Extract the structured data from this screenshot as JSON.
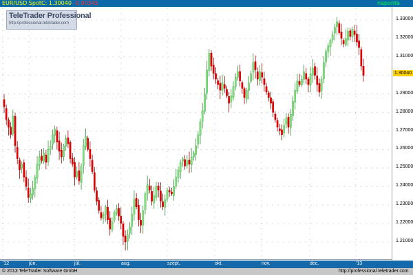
{
  "header": {
    "instrument": "EUR/USD Spot",
    "close_label": "C: 1.30040",
    "change": "-0.00345",
    "period": "naponta",
    "colors": {
      "instrument": "#ffff00",
      "close": "#ffff00",
      "change": "#ff3333",
      "period": "#00ff44",
      "bar": "#0a6aa8"
    }
  },
  "logo": {
    "title": "TeleTrader Professional",
    "url": "http://professional.teletrader.com"
  },
  "footer": {
    "copyright": "© 2013 TeleTrader Software GmbH",
    "site": "http://professional.teletrader.com"
  },
  "last_price_tag": "1.30040",
  "chart_data": {
    "type": "candlestick",
    "title": "",
    "ylim": [
      1.2,
      1.34
    ],
    "y_ticks": [
      "1.21000",
      "1.22000",
      "1.23000",
      "1.24000",
      "1.25000",
      "1.26000",
      "1.27000",
      "1.28000",
      "1.29000",
      "1.30000",
      "1.31000",
      "1.32000",
      "1.33000"
    ],
    "x_ticks": [
      "'12",
      "jún.",
      "júl.",
      "aug.",
      "szept.",
      "okt.",
      "nov.",
      "dec.",
      "'13"
    ],
    "grid": true,
    "colors": {
      "up": "#7fe07f",
      "down": "#e00000",
      "grid": "#888888"
    },
    "series": [
      {
        "name": "EUR/USD Spot",
        "close": [
          1.283,
          1.276,
          1.272,
          1.268,
          1.278,
          1.262,
          1.255,
          1.249,
          1.252,
          1.245,
          1.24,
          1.234,
          1.236,
          1.239,
          1.245,
          1.252,
          1.256,
          1.254,
          1.258,
          1.253,
          1.26,
          1.262,
          1.268,
          1.271,
          1.264,
          1.259,
          1.256,
          1.262,
          1.266,
          1.263,
          1.255,
          1.252,
          1.245,
          1.248,
          1.243,
          1.251,
          1.262,
          1.267,
          1.26,
          1.255,
          1.248,
          1.238,
          1.232,
          1.227,
          1.223,
          1.225,
          1.229,
          1.222,
          1.217,
          1.221,
          1.226,
          1.228,
          1.224,
          1.22,
          1.213,
          1.21,
          1.214,
          1.218,
          1.225,
          1.233,
          1.229,
          1.222,
          1.219,
          1.227,
          1.236,
          1.241,
          1.238,
          1.232,
          1.235,
          1.24,
          1.238,
          1.232,
          1.229,
          1.233,
          1.238,
          1.237,
          1.236,
          1.24,
          1.245,
          1.249,
          1.253,
          1.255,
          1.251,
          1.254,
          1.252,
          1.256,
          1.258,
          1.262,
          1.268,
          1.275,
          1.281,
          1.29,
          1.303,
          1.312,
          1.305,
          1.301,
          1.298,
          1.295,
          1.292,
          1.296,
          1.293,
          1.289,
          1.285,
          1.289,
          1.294,
          1.299,
          1.302,
          1.297,
          1.293,
          1.288,
          1.292,
          1.296,
          1.301,
          1.307,
          1.303,
          1.298,
          1.302,
          1.299,
          1.295,
          1.291,
          1.288,
          1.285,
          1.28,
          1.276,
          1.272,
          1.27,
          1.268,
          1.273,
          1.277,
          1.272,
          1.279,
          1.286,
          1.292,
          1.297,
          1.295,
          1.298,
          1.302,
          1.298,
          1.295,
          1.301,
          1.304,
          1.3,
          1.295,
          1.291,
          1.298,
          1.307,
          1.313,
          1.316,
          1.319,
          1.322,
          1.326,
          1.329,
          1.323,
          1.32,
          1.317,
          1.32,
          1.324,
          1.321,
          1.325,
          1.322,
          1.318,
          1.315,
          1.305,
          1.3
        ]
      }
    ]
  }
}
